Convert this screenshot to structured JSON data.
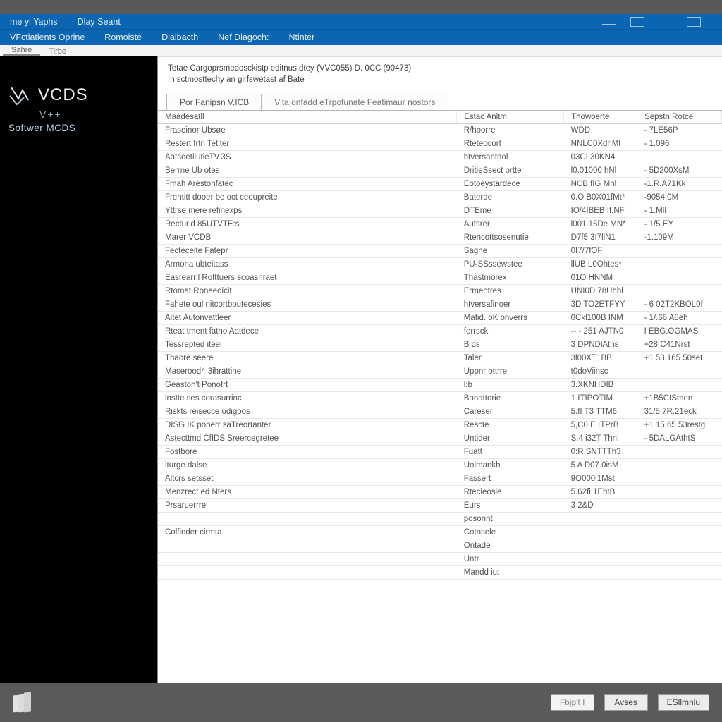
{
  "titlebar": {
    "text": ""
  },
  "menu1": {
    "items": [
      "me yl Yaphs",
      "Dlay Seant"
    ],
    "win_min": "—",
    "win_max": "☐",
    "win_close": "☐"
  },
  "menu2": {
    "items": [
      "VFctiatients Oprine",
      "Romoiste",
      "Diaibacth",
      "Nef Diagoch:",
      "Ntinter"
    ]
  },
  "minitabs": {
    "items": [
      "Sahre",
      "Tirbe"
    ]
  },
  "sidebar": {
    "brand": "VCDS",
    "sub": "V++",
    "line": "Softwer  MCDS"
  },
  "desc": {
    "line1": "Tetae Cargoprsmedosckistp editnus dtey (VVC055) D. 0CC (90473)",
    "line2": "In sctmosttechy an girfswetast af Bate"
  },
  "tabs": {
    "active": "Por Fanipsn V.ICB",
    "inactive": "Vita onfadd eTrpofunate Featimaur nostors"
  },
  "columns": [
    "Maadesatll",
    "Estac Anitm",
    "Thowoerte",
    "Sepstn Rotce"
  ],
  "rows": [
    [
      "Fraseinor Ubsøe",
      "R/hoorre",
      "WDD",
      "- 7LE56P"
    ],
    [
      "Restert frtn Tetiter",
      "Rtetecoort",
      "NNLC0XdhMl",
      "- 1.096"
    ],
    [
      "AatsoetilutieTV.3S",
      "htversantnol",
      "03CL30KN4",
      ""
    ],
    [
      "Berrne Ub otes",
      "DritieSsect ortte",
      "l0.01000 hNl",
      "- 5D200XsM"
    ],
    [
      "Fmah Arestonfatec",
      "Eotoeystardece",
      "NCB fIG Mhl",
      "-1.R.A71Kk"
    ],
    [
      "Frentitt dooer be oct ceoupreite",
      "Baterde",
      "0.O B0X01fMt*",
      "-9054.0M"
    ],
    [
      "Yttrse mere refinexps",
      "DTEme",
      "IO/4IBEB If.NF",
      "- 1.Mll"
    ],
    [
      "Rectur.d 85UTVTE:s",
      "Autsrer",
      "l001 15De MN*",
      "- 1/5.EY"
    ],
    [
      "Marer VCDB",
      "Rtencottsosenutie",
      "D7f5 3I7llN1",
      "-1.109M"
    ],
    [
      "Fecteceite Fatepr",
      "Sagne",
      "0I7/7fOF",
      ""
    ],
    [
      "Armona ubteitass",
      "PU-SSssewstee",
      "llUB.L0Ohtes*",
      ""
    ],
    [
      "Easrearrll Rotttuers scoasnraet",
      "Thastmorex",
      "01O HNNM",
      ""
    ],
    [
      "Rtomat Roneeoicit",
      "Ermeotres",
      "UNI0D 78Uhhl",
      ""
    ],
    [
      "Fahete oul nitcortboutecesies",
      "htversafinoer",
      "3D TO2ETFYY",
      "- 6 02T2KBOL0f"
    ],
    [
      "Aitet Autonvattleer",
      "Mafid. oK onverrs",
      "0Ckl100B INM",
      "- 1/.66 A8eh"
    ],
    [
      "Rteat tment fatno Aatdece",
      "ferrsck",
      "-- - 251 AJTN0",
      "I EBG.OGMAS"
    ],
    [
      "Tessrepted iteei",
      "B ds",
      "3 DPNDlAtns",
      "+28 C41Nrst"
    ],
    [
      "Thaore seere",
      "Taler",
      "3l00XT1BB",
      "+1 53.165 50set"
    ],
    [
      "Maserood4 3ihrattine",
      "Uppnr ottrre",
      "t0doViinsc",
      ""
    ],
    [
      "Geastoh't Ponofrt",
      "l:b",
      "3.XKNHDIB",
      ""
    ],
    [
      "lnstte ses corasurrinc",
      "Bonattorie",
      "1 ITIPOTIM",
      "+1B5CISmen"
    ],
    [
      "Riskts reisecce odigoos",
      "Careser",
      "5.fI T3 TTM6",
      "31/5 7R.21eck"
    ],
    [
      "DISG IK poherr saTreortanter",
      "Rescte",
      "5,C0 E ITPrB",
      "+1 15.65.53restg"
    ],
    [
      "Astecttmd CfIDS Sreercegretee",
      "Untider",
      "S.4 i32T Thnl",
      "- 5DALGAthtS"
    ],
    [
      "Fostbore",
      "Fuatt",
      "0:R SNTTTh3",
      ""
    ],
    [
      "lturge dalse",
      "Uolmankh",
      "5 A D07.0isM",
      ""
    ],
    [
      "Altcrs setsset",
      "Fassert",
      "9O000l1Mst",
      ""
    ],
    [
      "Menzrect ed Nters",
      "Rtecieosle",
      "5.62fi 1EhtB",
      ""
    ],
    [
      "Prsaruerrre",
      "Eurs",
      "3 2&D",
      ""
    ],
    [
      "",
      "posonnt",
      "",
      ""
    ],
    [
      "Colfinder cirmta",
      "Cotnsele",
      "",
      ""
    ],
    [
      "",
      "Ontade",
      "",
      ""
    ],
    [
      "",
      "Untr",
      "",
      ""
    ],
    [
      "",
      "Mandd iut",
      "",
      ""
    ]
  ],
  "footer": {
    "buttons": [
      "Fbjp't I",
      "Avses",
      "ESllmnlu"
    ]
  }
}
